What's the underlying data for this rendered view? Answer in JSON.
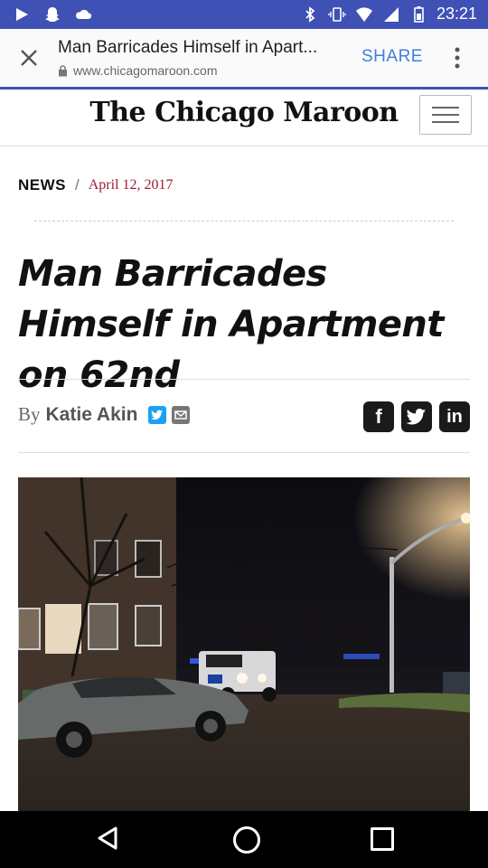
{
  "status_bar": {
    "time": "23:21",
    "icons": [
      "play-icon",
      "snapchat-icon",
      "cloud-icon",
      "bluetooth-icon",
      "vibrate-icon",
      "wifi-icon",
      "signal-icon",
      "battery-icon"
    ]
  },
  "browser": {
    "page_title": "Man Barricades Himself in Apart...",
    "url": "www.chicagomaroon.com",
    "share_label": "SHARE",
    "accent_color": "#3f51b5"
  },
  "site": {
    "logo_text": "The Chicago Maroon"
  },
  "article": {
    "section": "NEWS",
    "separator": "/",
    "date": "April 12, 2017",
    "headline": "Man Barricades Himself in Apartment on 62nd",
    "byline_prefix": "By",
    "author": "Katie Akin",
    "photo_alt": "night-street-police-armored-vehicle"
  },
  "social": {
    "facebook": "f",
    "twitter": "t",
    "linkedin": "in"
  },
  "colors": {
    "date_red": "#9e1b32",
    "share_blue": "#3f7fe0",
    "twitter_blue": "#1da1f2"
  }
}
